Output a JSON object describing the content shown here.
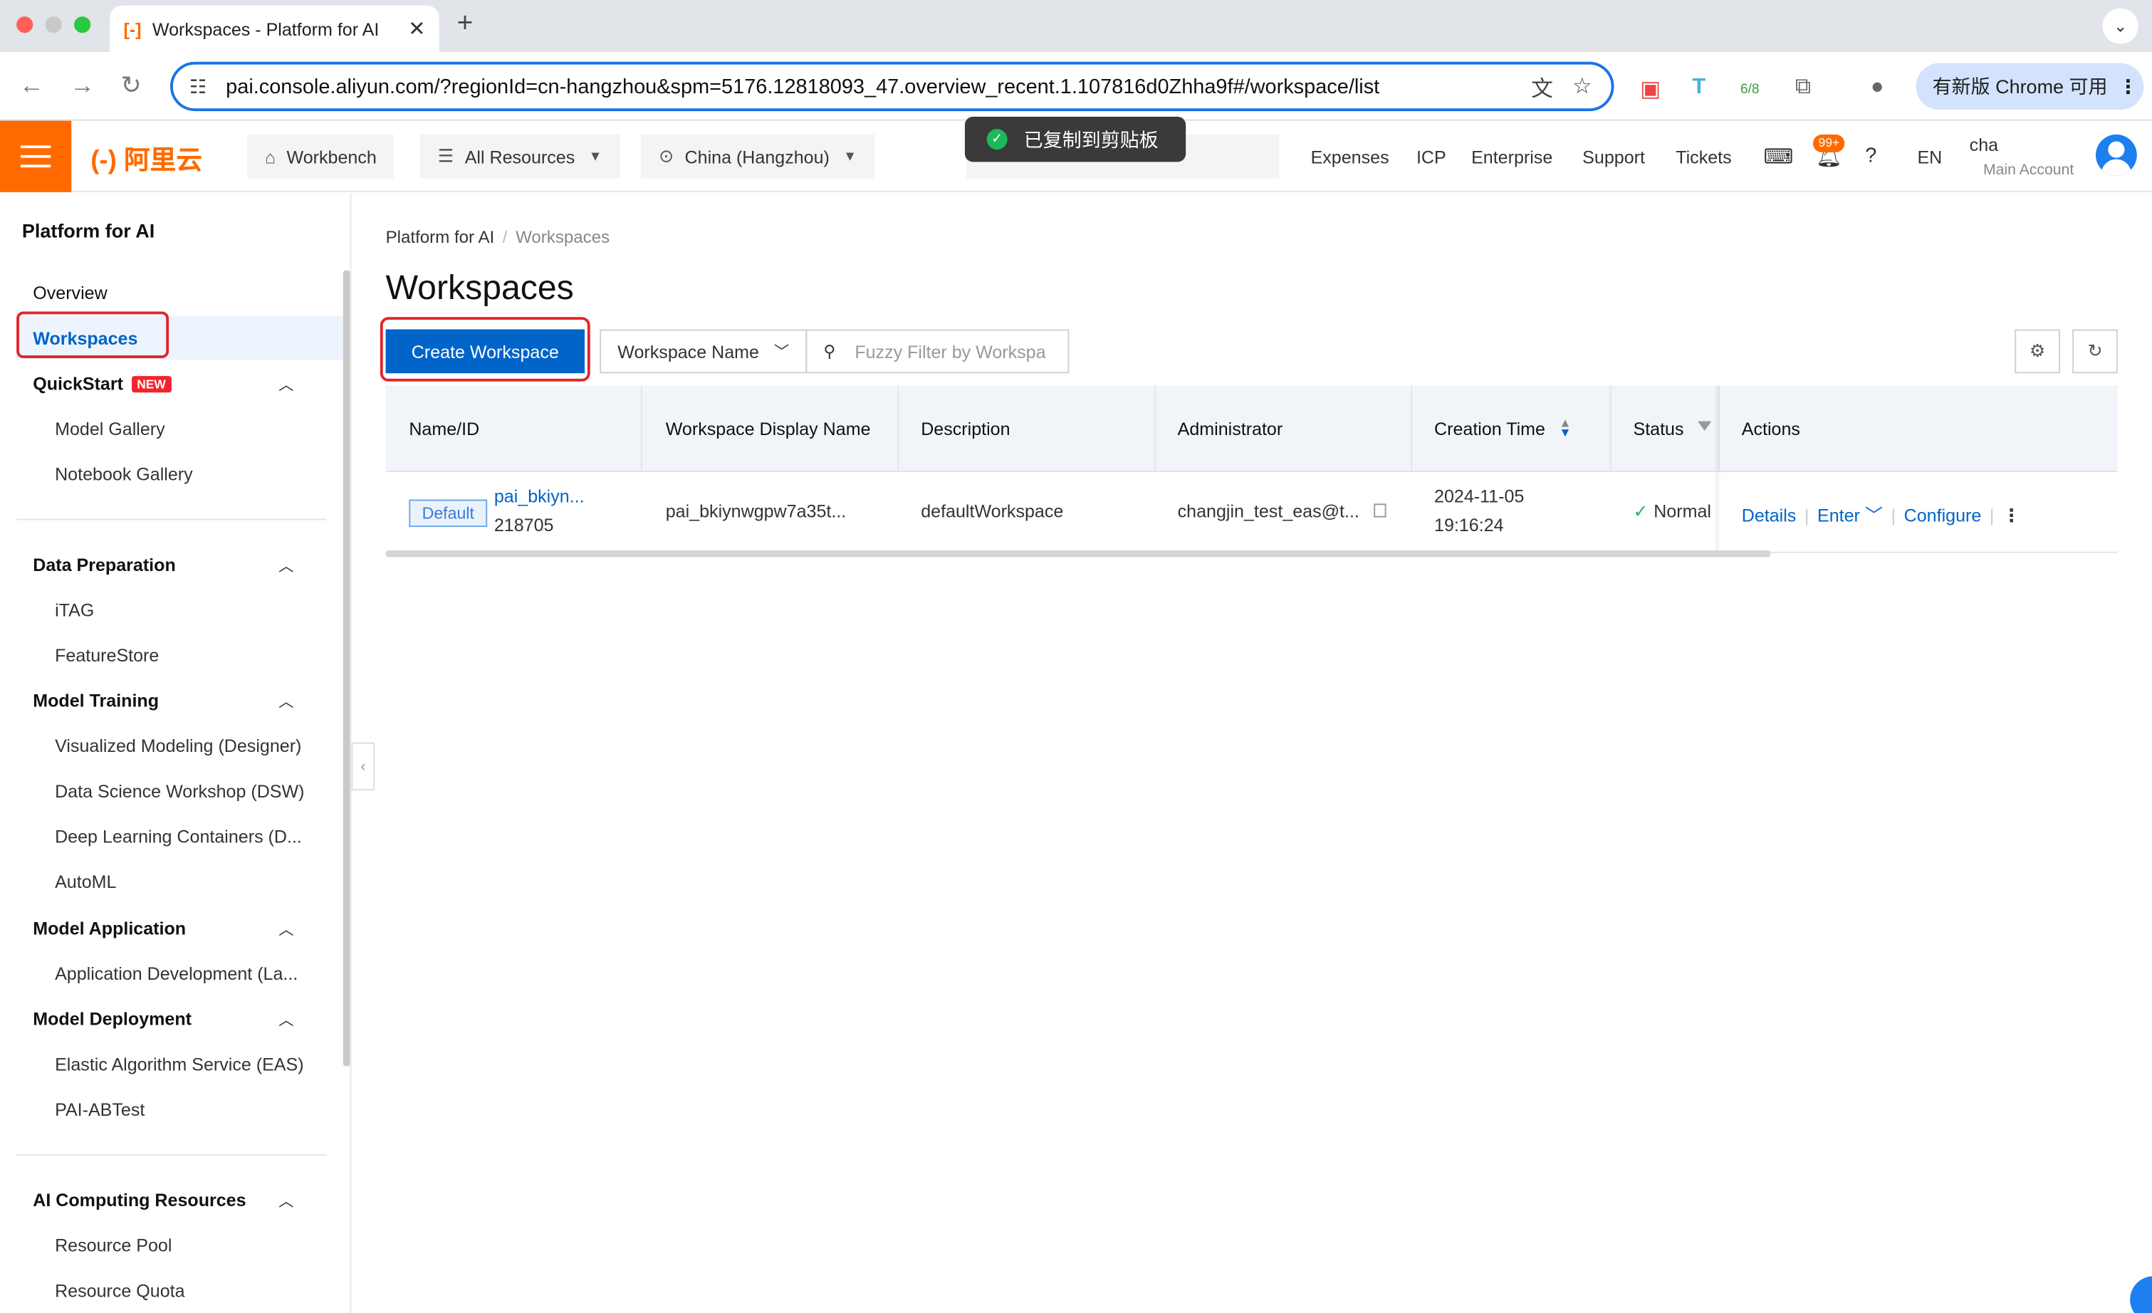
{
  "browser": {
    "tab_title": "Workspaces - Platform for AI",
    "tab_favicon": "[-]",
    "new_tab": "+",
    "url": "pai.console.aliyun.com/?regionId=cn-hangzhou&spm=5176.12818093_47.overview_recent.1.107816d0Zhha9f#/workspace/list",
    "chrome_update": "有新版 Chrome 可用",
    "ext_badge": "6/8"
  },
  "header": {
    "logo": "(-) 阿里云",
    "workbench": "Workbench",
    "all_resources": "All Resources",
    "region": "China (Hangzhou)",
    "search_placeholder": "Search...",
    "links": [
      "Expenses",
      "ICP",
      "Enterprise",
      "Support",
      "Tickets"
    ],
    "notif_badge": "99+",
    "lang": "EN",
    "account_name": "cha",
    "account_sub": "Main Account"
  },
  "toast": {
    "text": "已复制到剪贴板"
  },
  "sidebar": {
    "title": "Platform for AI",
    "overview": "Overview",
    "workspaces": "Workspaces",
    "quickstart": "QuickStart",
    "new_badge": "NEW",
    "quickstart_items": [
      "Model Gallery",
      "Notebook Gallery"
    ],
    "groups": [
      {
        "label": "Data Preparation",
        "items": [
          "iTAG",
          "FeatureStore"
        ]
      },
      {
        "label": "Model Training",
        "items": [
          "Visualized Modeling (Designer)",
          "Data Science Workshop (DSW)",
          "Deep Learning Containers (D...",
          "AutoML"
        ]
      },
      {
        "label": "Model Application",
        "items": [
          "Application Development (La..."
        ]
      },
      {
        "label": "Model Deployment",
        "items": [
          "Elastic Algorithm Service (EAS)",
          "PAI-ABTest"
        ]
      },
      {
        "label": "AI Computing Resources",
        "items": [
          "Resource Pool",
          "Resource Quota"
        ]
      }
    ]
  },
  "main": {
    "breadcrumb": [
      "Platform for AI",
      "Workspaces"
    ],
    "title": "Workspaces",
    "create_button": "Create Workspace",
    "filter_select": "Workspace Name",
    "filter_placeholder": "Fuzzy Filter by Workspa",
    "table": {
      "headers": [
        "Name/ID",
        "Workspace Display Name",
        "Description",
        "Administrator",
        "Creation Time",
        "Status",
        "Actions"
      ],
      "rows": [
        {
          "tag": "Default",
          "name": "pai_bkiyn...",
          "id": "218705",
          "display_name": "pai_bkiynwgpw7a35t...",
          "description": "defaultWorkspace",
          "administrator": "changjin_test_eas@t...",
          "creation_date": "2024-11-05",
          "creation_time": "19:16:24",
          "status": "Normal",
          "actions": [
            "Details",
            "Enter",
            "Configure"
          ]
        }
      ]
    }
  },
  "colors": {
    "brand_orange": "#ff6a00",
    "primary_blue": "#0064c8",
    "highlight_red": "#e0242c",
    "status_green": "#1eb85b"
  }
}
